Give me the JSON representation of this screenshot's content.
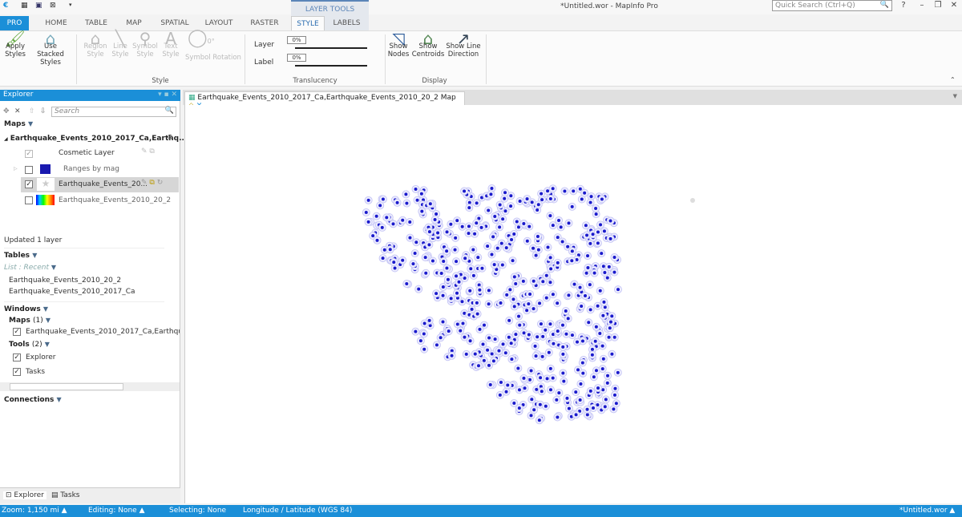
{
  "app": {
    "title": "*Untitled.wor - MapInfo Pro",
    "quick_search_placeholder": "Quick Search (Ctrl+Q)",
    "help": "?",
    "minimize": "–",
    "restore": "❐",
    "close": "✕"
  },
  "ribbon_tabs": [
    "PRO",
    "HOME",
    "TABLE",
    "MAP",
    "SPATIAL",
    "LAYOUT",
    "RASTER",
    "STYLE",
    "LABELS"
  ],
  "contextual_group": "LAYER TOOLS",
  "ribbon": {
    "apply_styles": "Apply Styles",
    "use_stacked": "Use Stacked Styles",
    "region_style": "Region Style",
    "line_style": "Line Style",
    "symbol_style": "Symbol Style",
    "text_style": "Text Style",
    "symbol_rotation": "Symbol Rotation",
    "rotation_value": "0°",
    "style_group": "Style",
    "layer_label": "Layer",
    "label_label": "Label",
    "layer_translucency": "0%",
    "label_translucency": "0%",
    "translucency_group": "Translucency",
    "show_nodes": "Show Nodes",
    "show_centroids": "Show Centroids",
    "show_line_direction": "Show Line Direction",
    "display_group": "Display"
  },
  "explorer": {
    "title": "Explorer",
    "search_placeholder": "Search",
    "maps_header": "Maps",
    "map_name": "Earthquake_Events_2010_2017_Ca,Earthq...",
    "layers": [
      {
        "name": "Cosmetic Layer",
        "checked": true
      },
      {
        "name": "Ranges by mag",
        "checked": false
      },
      {
        "name": "Earthquake_Events_20...",
        "checked": true
      },
      {
        "name": "Earthquake_Events_2010_20_2",
        "checked": false
      }
    ],
    "status": "Updated 1 layer",
    "tables_header": "Tables",
    "list_mode": "List : Recent",
    "tables": [
      "Earthquake_Events_2010_20_2",
      "Earthquake_Events_2010_2017_Ca"
    ],
    "windows_header": "Windows",
    "maps_sub": "Maps",
    "maps_count": "(1)",
    "map_window": "Earthquake_Events_2010_2017_Ca,Earthquake_Ev",
    "tools_sub": "Tools",
    "tools_count": "(2)",
    "tools": [
      "Explorer",
      "Tasks"
    ],
    "connections_header": "Connections",
    "bottom_tabs": [
      "Explorer",
      "Tasks"
    ]
  },
  "document_tab": "Earthquake_Events_2010_2017_Ca,Earthquake_Events_2010_20_2 Map",
  "colors": {
    "accent": "#1b8fd8",
    "point": "#1a1acc",
    "point_halo": "#c8c8f5"
  },
  "status": {
    "zoom": "Zoom: 1,150 mi",
    "editing": "Editing: None",
    "selecting": "Selecting: None",
    "projection": "Longitude / Latitude (WGS 84)",
    "workspace": "*Untitled.wor"
  }
}
